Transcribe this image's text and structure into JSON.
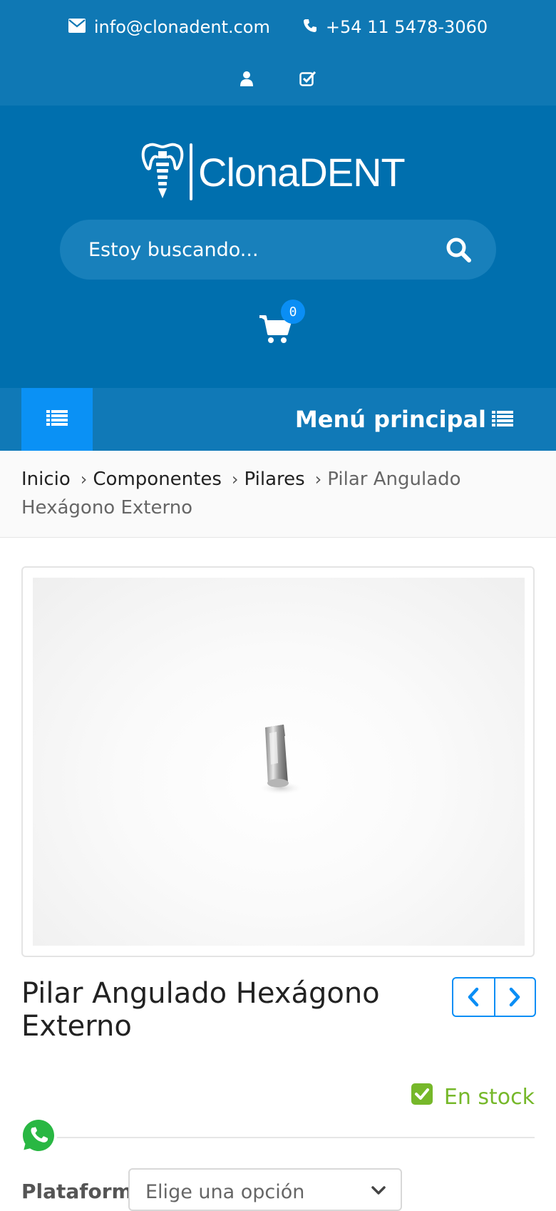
{
  "topbar": {
    "email": "info@clonadent.com",
    "phone": "+54 11 5478-3060",
    "icons": [
      "envelope-icon",
      "phone-icon",
      "user-icon",
      "checkbox-icon"
    ]
  },
  "header": {
    "logo_text": "ClonaDENT",
    "search_placeholder": "Estoy buscando...",
    "cart_count": "0"
  },
  "nav": {
    "menu_label": "Menú principal"
  },
  "breadcrumb": [
    "Inicio",
    "Componentes",
    "Pilares",
    "Pilar Angulado Hexágono Externo"
  ],
  "product": {
    "title": "Pilar Angulado Hexágono Externo",
    "stock": "En stock",
    "variation_label": "Plataforma",
    "variation_selected": "Elige una opción"
  },
  "colors": {
    "topbar": "#0f78b4",
    "header": "#006fae",
    "accent": "#0a8ef5",
    "stock": "#76b82a"
  }
}
